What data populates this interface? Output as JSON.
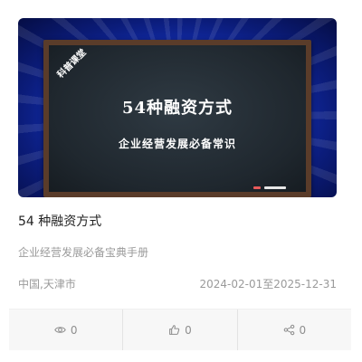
{
  "cover": {
    "ribbon": "科普课堂",
    "title": "54种融资方式",
    "subtitle": "企业经营发展必备常识"
  },
  "card": {
    "title": "54 种融资方式",
    "description": "企业经营发展必备宝典手册",
    "location": "中国,天津市",
    "date_range": "2024-02-01至2025-12-31"
  },
  "stats": {
    "views": "0",
    "likes": "0",
    "shares": "0"
  },
  "icons": [
    "eye-icon",
    "thumbs-up-icon",
    "share-icon"
  ]
}
